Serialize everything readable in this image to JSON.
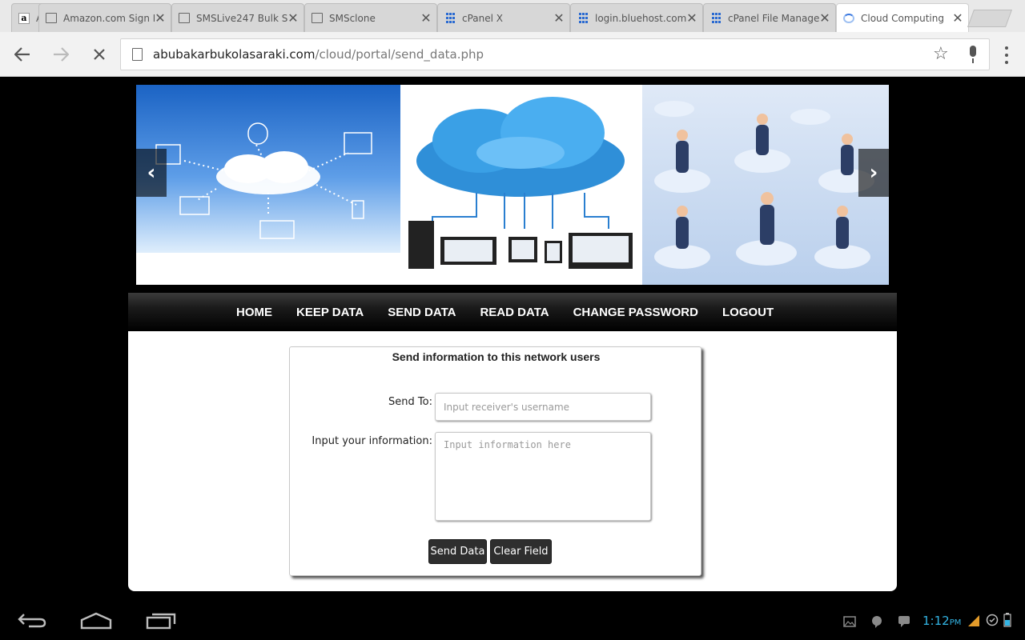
{
  "browser": {
    "tabs": [
      {
        "title": "A",
        "icon": "amazon-icon",
        "active": false
      },
      {
        "title": "Amazon.com Sign I",
        "icon": "page-icon",
        "active": false
      },
      {
        "title": "SMSLive247 Bulk S",
        "icon": "page-icon",
        "active": false
      },
      {
        "title": "SMSclone",
        "icon": "page-icon",
        "active": false
      },
      {
        "title": "cPanel X",
        "icon": "cpanel-grid-icon",
        "active": false
      },
      {
        "title": "login.bluehost.com",
        "icon": "cpanel-grid-icon",
        "active": false
      },
      {
        "title": "cPanel File Manage",
        "icon": "cpanel-grid-icon",
        "active": false
      },
      {
        "title": "Cloud Computing",
        "icon": "loading-spinner-icon",
        "active": true
      }
    ],
    "url_host": "abubakarbukolasaraki.com",
    "url_path": "/cloud/portal/send_data.php"
  },
  "site": {
    "banner": {
      "prev_label": "‹",
      "next_label": "›"
    },
    "nav": [
      "HOME",
      "KEEP DATA",
      "SEND DATA",
      "READ DATA",
      "CHANGE PASSWORD",
      "LOGOUT"
    ],
    "form": {
      "title": "Send information to this network users",
      "send_to_label": "Send To:",
      "send_to_placeholder": "Input receiver's username",
      "info_label": "Input your information:",
      "info_placeholder": "Input information here",
      "send_button": "Send Data",
      "clear_button": "Clear Field"
    }
  },
  "system": {
    "time": "1:12",
    "ampm": "PM",
    "accent_color": "#33b5e5"
  }
}
